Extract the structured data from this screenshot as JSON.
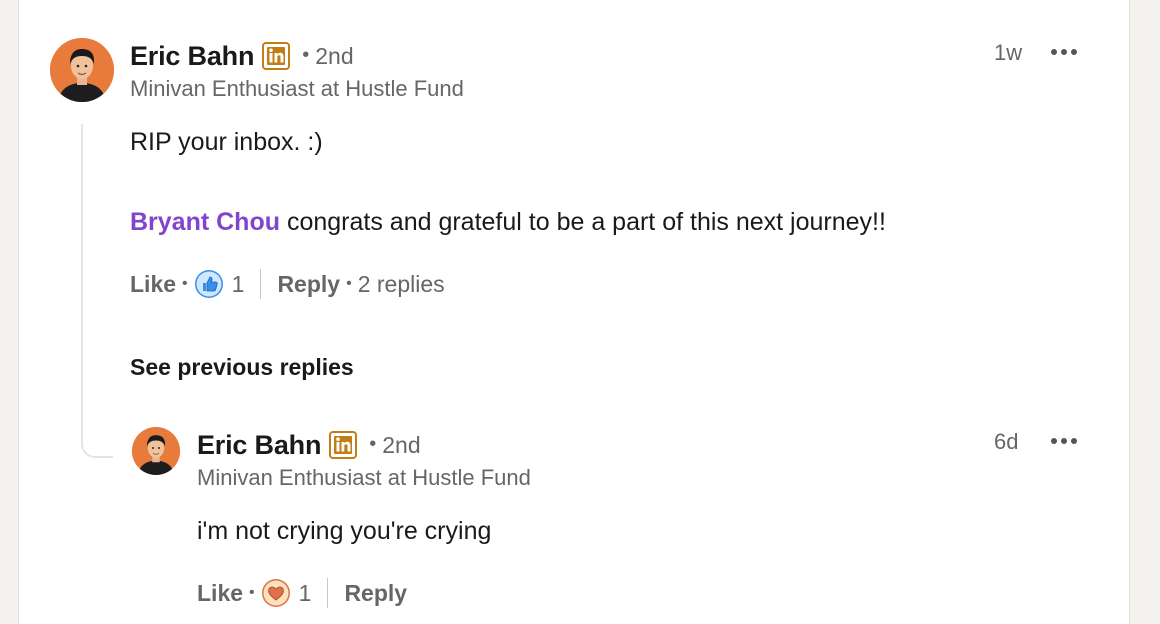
{
  "comment": {
    "author": "Eric Bahn",
    "degree": "2nd",
    "headline": "Minivan Enthusiast at Hustle Fund",
    "time": "1w",
    "text_line1": "RIP your inbox. :)",
    "mention": "Bryant Chou",
    "text_line2": "congrats and grateful to be a part of this next journey!!",
    "like_label": "Like",
    "reaction_count": "1",
    "reaction_icon": "thumbs-up-icon",
    "reply_label": "Reply",
    "replies_label": "2 replies"
  },
  "see_previous_label": "See previous replies",
  "reply": {
    "author": "Eric Bahn",
    "degree": "2nd",
    "headline": "Minivan Enthusiast at Hustle Fund",
    "time": "6d",
    "text": "i'm not crying you're crying",
    "like_label": "Like",
    "reaction_count": "1",
    "reaction_icon": "heart-icon",
    "reply_label": "Reply"
  },
  "colors": {
    "mention": "#8344cc",
    "linkedin_badge": "#c37d16",
    "avatar_bg": "#e87b3c",
    "like_reaction": "#378fe9",
    "love_reaction": "#df704d"
  }
}
